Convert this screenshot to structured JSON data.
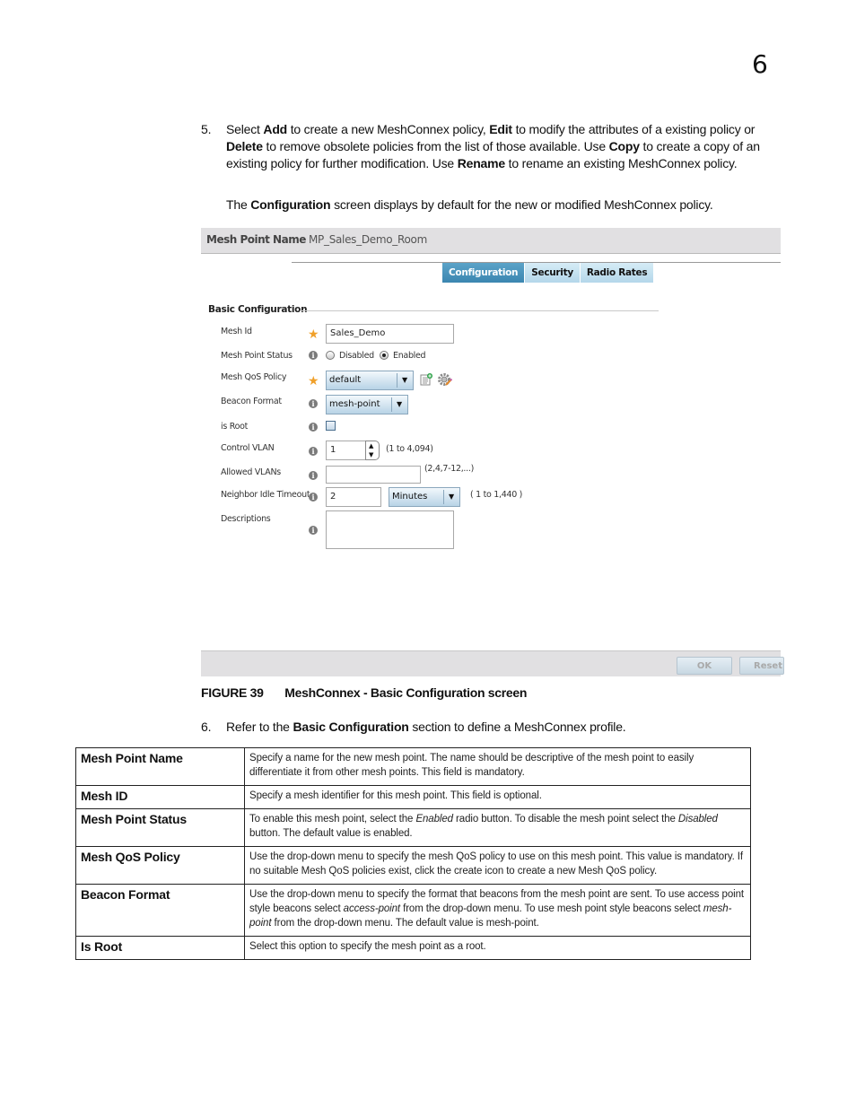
{
  "chapter_number": "6",
  "step5": {
    "number": "5.",
    "segments": [
      {
        "t": "Select ",
        "b": false
      },
      {
        "t": "Add",
        "b": true
      },
      {
        "t": " to create a new MeshConnex policy, ",
        "b": false
      },
      {
        "t": "Edit",
        "b": true
      },
      {
        "t": " to modify the attributes of a existing policy or ",
        "b": false
      },
      {
        "t": "Delete",
        "b": true
      },
      {
        "t": " to remove obsolete policies from the list of those available. Use ",
        "b": false
      },
      {
        "t": "Copy",
        "b": true
      },
      {
        "t": " to create a copy of an existing policy for further modification. Use ",
        "b": false
      },
      {
        "t": "Rename",
        "b": true
      },
      {
        "t": " to rename an existing MeshConnex policy.",
        "b": false
      }
    ],
    "note_segments": [
      {
        "t": "The ",
        "b": false
      },
      {
        "t": "Configuration",
        "b": true
      },
      {
        "t": " screen displays by default for the new or modified MeshConnex policy.",
        "b": false
      }
    ]
  },
  "figure": {
    "header_label": "Mesh Point Name",
    "header_value": "MP_Sales_Demo_Room",
    "tabs": [
      {
        "label": "Configuration",
        "active": true
      },
      {
        "label": "Security",
        "active": false
      },
      {
        "label": "Radio Rates",
        "active": false
      }
    ],
    "section_title": "Basic Configuration",
    "fields": {
      "mesh_id": {
        "label": "Mesh Id",
        "value": "Sales_Demo"
      },
      "mesh_point_status": {
        "label": "Mesh Point Status",
        "options": [
          "Disabled",
          "Enabled"
        ],
        "selected": "Enabled"
      },
      "mesh_qos_policy": {
        "label": "Mesh QoS Policy",
        "value": "default"
      },
      "beacon_format": {
        "label": "Beacon Format",
        "value": "mesh-point"
      },
      "is_root": {
        "label": "is Root",
        "checked": false
      },
      "control_vlan": {
        "label": "Control VLAN",
        "value": "1",
        "hint": "(1 to 4,094)"
      },
      "allowed_vlans": {
        "label": "Allowed VLANs",
        "value": "",
        "hint": "(2,4,7-12,...)"
      },
      "neighbor_idle_timeout": {
        "label": "Neighbor Idle Timeout",
        "value": "2",
        "unit": "Minutes",
        "hint": "( 1 to 1,440 )"
      },
      "descriptions": {
        "label": "Descriptions",
        "value": ""
      }
    },
    "buttons": {
      "ok": "OK",
      "reset": "Reset"
    }
  },
  "caption": {
    "figure_number": "FIGURE 39",
    "title": "MeshConnex - Basic Configuration screen"
  },
  "step6": {
    "number": "6.",
    "segments": [
      {
        "t": "Refer to the ",
        "b": false
      },
      {
        "t": "Basic Configuration",
        "b": true
      },
      {
        "t": " section to define a MeshConnex profile.",
        "b": false
      }
    ]
  },
  "table": {
    "rows": [
      {
        "field": "Mesh Point Name",
        "desc": [
          {
            "t": "Specify a name for the new mesh point. The name should be descriptive of the mesh point to easily differentiate it from other mesh points. This field is mandatory.",
            "i": false
          }
        ]
      },
      {
        "field": "Mesh ID",
        "desc": [
          {
            "t": "Specify a mesh identifier for this mesh point. This field is optional.",
            "i": false
          }
        ]
      },
      {
        "field": "Mesh Point Status",
        "desc": [
          {
            "t": "To enable this mesh point, select the ",
            "i": false
          },
          {
            "t": "Enabled",
            "i": true
          },
          {
            "t": " radio button. To disable the mesh point select the ",
            "i": false
          },
          {
            "t": "Disabled",
            "i": true
          },
          {
            "t": " button. The default value is enabled.",
            "i": false
          }
        ]
      },
      {
        "field": "Mesh QoS Policy",
        "desc": [
          {
            "t": "Use the drop-down menu to specify the mesh QoS policy to use on this mesh point. This value is mandatory. If no suitable Mesh QoS policies exist, click the create icon to create a new Mesh QoS policy.",
            "i": false
          }
        ]
      },
      {
        "field": "Beacon Format",
        "desc": [
          {
            "t": "Use the drop-down menu to specify the format that beacons from the mesh point are sent. To use access point style beacons select ",
            "i": false
          },
          {
            "t": "access-point",
            "i": true
          },
          {
            "t": " from the drop-down menu. To use mesh point style beacons select ",
            "i": false
          },
          {
            "t": "mesh-point",
            "i": true
          },
          {
            "t": " from the drop-down menu. The default value is mesh-point.",
            "i": false
          }
        ]
      },
      {
        "field": "Is Root",
        "desc": [
          {
            "t": "Select this option to specify the mesh point as a root.",
            "i": false
          }
        ]
      }
    ]
  }
}
